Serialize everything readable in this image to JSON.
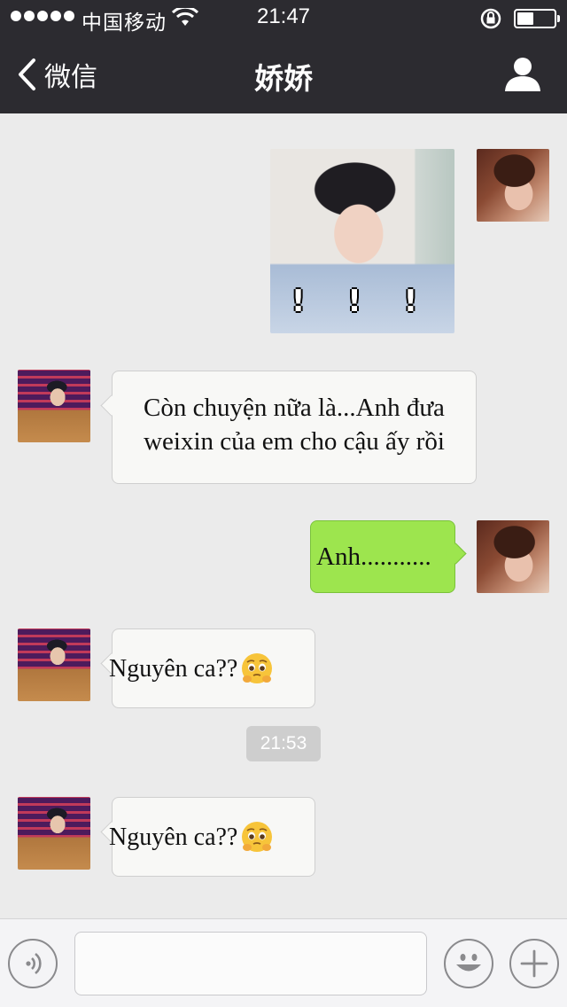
{
  "status_bar": {
    "carrier": "中国移动",
    "time": "21:47"
  },
  "nav": {
    "back_label": "微信",
    "title": "娇娇"
  },
  "messages": {
    "photo_overlay": "! ! !",
    "m1": "Còn chuyện nữa là...Anh đưa weixin của em cho cậu ấy rồi",
    "m2": "Anh...........",
    "m3": "Nguyên ca??",
    "m3_emoji": "pleading-face-emoji",
    "timestamp": "21:53",
    "m4": "Nguyên ca??",
    "m4_emoji": "pleading-face-emoji"
  },
  "input_bar": {
    "text_value": "",
    "voice_icon": "voice-icon",
    "emoji_icon": "smiley-icon",
    "plus_icon": "plus-icon"
  },
  "colors": {
    "header_bg": "#2c2b30",
    "chat_bg": "#ebebeb",
    "outgoing_bubble": "#9de54e",
    "incoming_bubble": "#f8f8f6",
    "timestamp_bg": "#cecece"
  }
}
